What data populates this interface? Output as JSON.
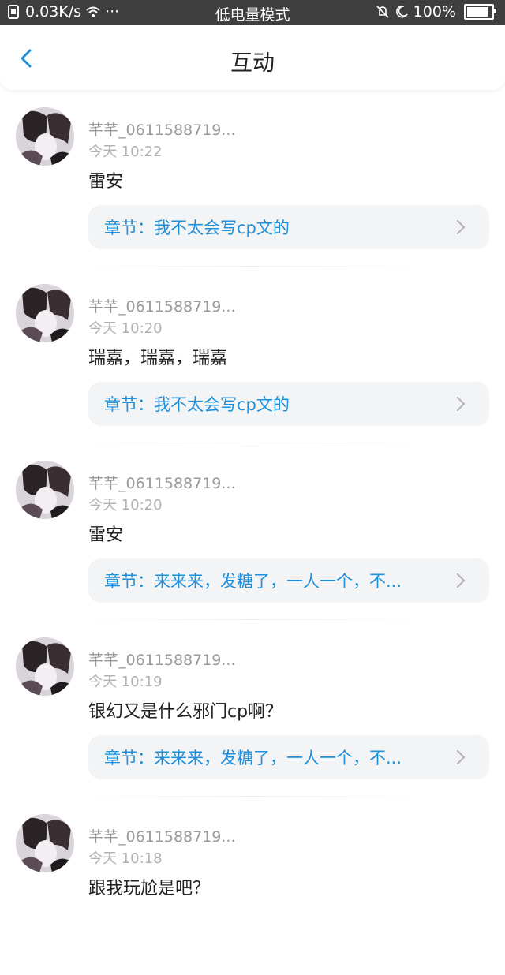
{
  "status_bar": {
    "speed": "0.03K/s",
    "dots": "···",
    "mode": "低电量模式",
    "battery_text": "100%",
    "battery_level": 1.0
  },
  "header": {
    "title": "互动",
    "back_icon": "back-arrow-icon",
    "accent": "#1e8fd8"
  },
  "interactions": [
    {
      "name": "芊芊_0611588719...",
      "time": "今天 10:22",
      "text": "雷安",
      "chapter": "章节：我不太会写cp文的"
    },
    {
      "name": "芊芊_0611588719...",
      "time": "今天 10:20",
      "text": "瑞嘉，瑞嘉，瑞嘉",
      "chapter": "章节：我不太会写cp文的"
    },
    {
      "name": "芊芊_0611588719...",
      "time": "今天 10:20",
      "text": "雷安",
      "chapter": "章节：来来来，发糖了，一人一个，不..."
    },
    {
      "name": "芊芊_0611588719...",
      "time": "今天 10:19",
      "text": "银幻又是什么邪门cp啊？",
      "chapter": "章节：来来来，发糖了，一人一个，不..."
    },
    {
      "name": "芊芊_0611588719...",
      "time": "今天 10:18",
      "text": "跟我玩尬是吧？",
      "chapter": ""
    }
  ]
}
